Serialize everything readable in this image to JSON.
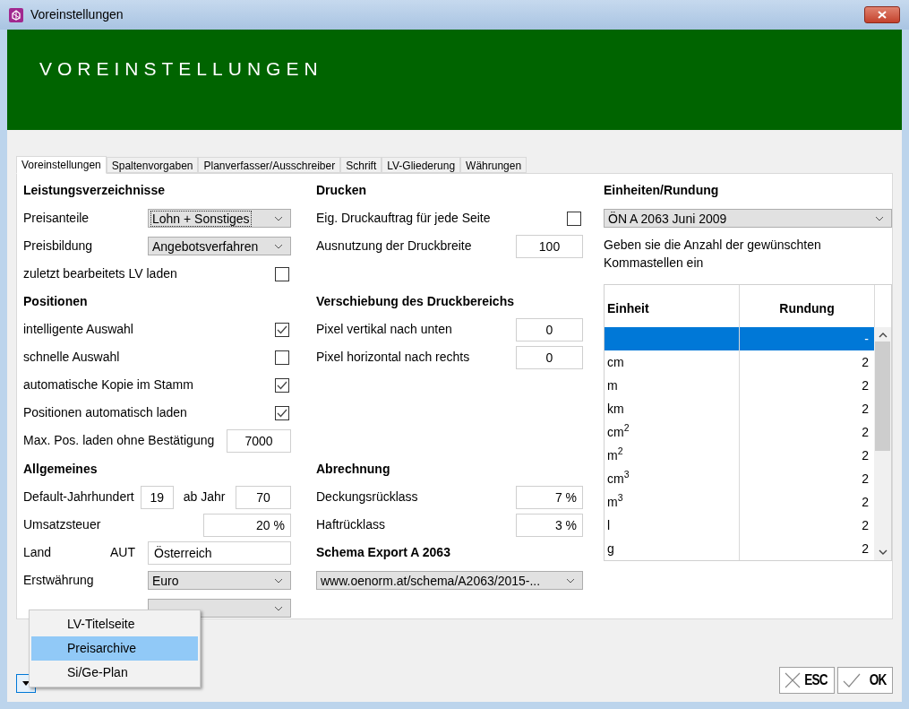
{
  "window": {
    "title": "Voreinstellungen"
  },
  "banner": {
    "title": "VOREINSTELLUNGEN"
  },
  "tabs": [
    {
      "label": "Voreinstellungen",
      "selected": true
    },
    {
      "label": "Spaltenvorgaben",
      "selected": false
    },
    {
      "label": "Planverfasser/Ausschreiber",
      "selected": false
    },
    {
      "label": "Schrift",
      "selected": false
    },
    {
      "label": "LV-Gliederung",
      "selected": false
    },
    {
      "label": "Währungen",
      "selected": false
    }
  ],
  "left_column": {
    "sections": [
      {
        "heading": "Leistungsverzeichnisse",
        "rows": [
          {
            "kind": "select",
            "label": "Preisanteile",
            "value": "Lohn + Sonstiges",
            "focused": true
          },
          {
            "kind": "select",
            "label": "Preisbildung",
            "value": "Angebotsverfahren",
            "focused": false
          },
          {
            "kind": "checkbox",
            "label": "zuletzt bearbeitets LV laden",
            "checked": false
          }
        ]
      },
      {
        "heading": "Positionen",
        "rows": [
          {
            "kind": "checkbox",
            "label": "intelligente Auswahl",
            "checked": true
          },
          {
            "kind": "checkbox",
            "label": "schnelle Auswahl",
            "checked": false
          },
          {
            "kind": "checkbox",
            "label": "automatische Kopie im Stamm",
            "checked": true
          },
          {
            "kind": "checkbox",
            "label": "Positionen automatisch laden",
            "checked": true
          },
          {
            "kind": "number",
            "label": "Max. Pos. laden ohne Bestätigung",
            "value": "7000"
          }
        ]
      },
      {
        "heading": "Allgemeines",
        "rows": [
          {
            "kind": "pair",
            "label": "Default-Jahrhundert",
            "value": "19",
            "label2": "ab Jahr",
            "value2": "70"
          },
          {
            "kind": "number",
            "label": "Umsatzsteuer",
            "value": "20 %"
          },
          {
            "kind": "text",
            "label": "Land",
            "code": "AUT",
            "value": "Österreich"
          },
          {
            "kind": "select",
            "label": "Erstwährung",
            "value": "Euro",
            "focused": false
          },
          {
            "kind": "select"
          }
        ]
      }
    ]
  },
  "middle_column": {
    "sections": [
      {
        "heading": "Drucken",
        "rows": [
          {
            "kind": "checkbox",
            "label": "Eig. Druckauftrag für jede Seite",
            "checked": false
          },
          {
            "kind": "number",
            "label": "Ausnutzung der Druckbreite",
            "value": "100"
          }
        ]
      },
      {
        "heading": "Verschiebung des Druckbereichs",
        "rows": [
          {
            "kind": "number",
            "label": "Pixel vertikal nach unten",
            "value": "0"
          },
          {
            "kind": "number",
            "label": "Pixel horizontal nach rechts",
            "value": "0"
          }
        ]
      },
      {
        "heading": "Abrechnung",
        "rows": [
          {
            "kind": "number",
            "label": "Deckungsrücklass",
            "value": "7 %"
          },
          {
            "kind": "number",
            "label": "Haftrücklass",
            "value": "3 %"
          }
        ]
      },
      {
        "heading": "Schema Export A 2063",
        "rows": [
          {
            "kind": "wide_select",
            "value": "www.oenorm.at/schema/A2063/2015-..."
          }
        ]
      }
    ]
  },
  "right_column": {
    "heading": "Einheiten/Rundung",
    "select": "ÖN A 2063 Juni 2009",
    "note": "Geben sie die Anzahl der gewünschten Kommastellen ein",
    "table": {
      "columns": [
        "Einheit",
        "Rundung"
      ],
      "rows": [
        {
          "unit": "",
          "rounding": "-",
          "selected": true
        },
        {
          "unit": "cm",
          "rounding": "2",
          "selected": false
        },
        {
          "unit": "m",
          "rounding": "2",
          "selected": false
        },
        {
          "unit": "km",
          "rounding": "2",
          "selected": false
        },
        {
          "unit": "cm$^{2}$",
          "rounding": "2",
          "selected": false
        },
        {
          "unit": "m$^{2}$",
          "rounding": "2",
          "selected": false
        },
        {
          "unit": "cm$^{3}$",
          "rounding": "2",
          "selected": false
        },
        {
          "unit": "m$^{3}$",
          "rounding": "2",
          "selected": false
        },
        {
          "unit": "l",
          "rounding": "2",
          "selected": false
        },
        {
          "unit": "g",
          "rounding": "2",
          "selected": false
        }
      ]
    }
  },
  "popup_menu": {
    "items": [
      {
        "label": "LV-Titelseite",
        "selected": false
      },
      {
        "label": "Preisarchive",
        "selected": true
      },
      {
        "label": "Si/Ge-Plan",
        "selected": false
      }
    ]
  },
  "buttons": [
    {
      "kind": "cancel",
      "label": "ESC"
    },
    {
      "kind": "ok",
      "label": "OK"
    }
  ]
}
